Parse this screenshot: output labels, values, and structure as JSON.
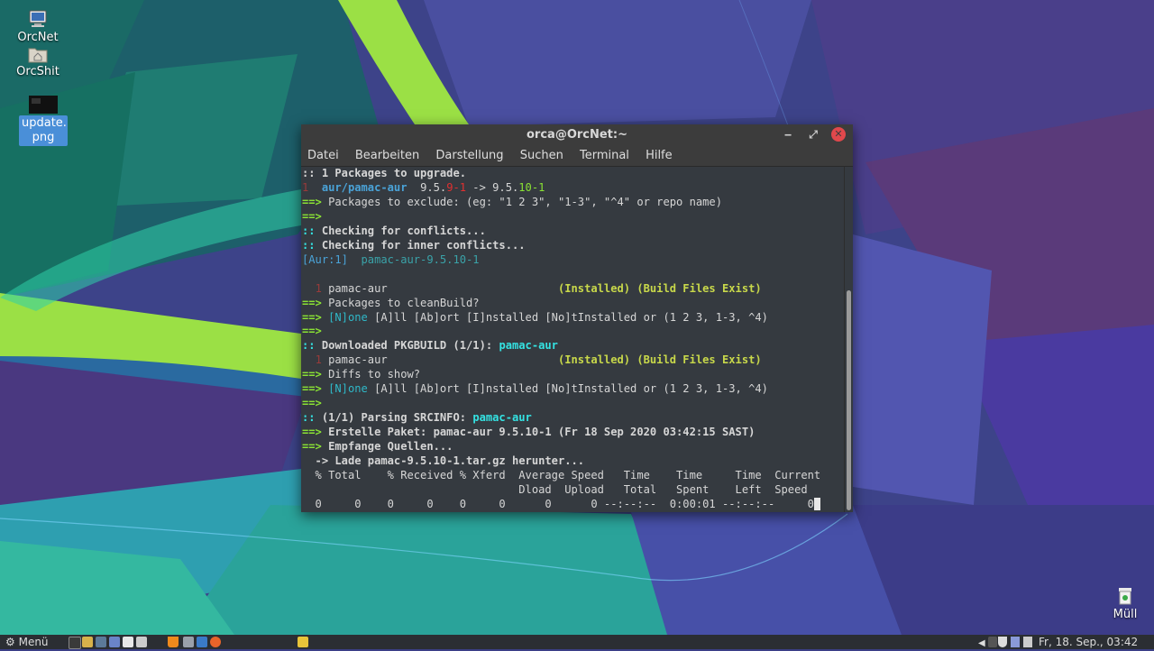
{
  "desktop": {
    "icons": [
      {
        "label": "OrcNet",
        "icon": "computer-icon"
      },
      {
        "label": "OrcShit",
        "icon": "home-folder-icon"
      },
      {
        "label": "update.\npng",
        "icon": "image-file-icon"
      },
      {
        "label": "Müll",
        "icon": "trash-icon"
      }
    ]
  },
  "window": {
    "title": "orca@OrcNet:~",
    "buttons": {
      "minimize": "‒",
      "maximize": "⤢",
      "close": "✕"
    },
    "menu": [
      "Datei",
      "Bearbeiten",
      "Darstellung",
      "Suchen",
      "Terminal",
      "Hilfe"
    ]
  },
  "terminal": {
    "l1": ":: 1 Packages to upgrade.",
    "l2_num": "1",
    "l2_pkg": "aur/pamac-aur",
    "l2_ver_a": "9.5.",
    "l2_ver_b": "9-1",
    "l2_arrow": " -> 9.5.",
    "l2_ver_c": "10-1",
    "l3": "Packages to exclude: (eg: \"1 2 3\", \"1-3\", \"^4\" or repo name)",
    "arrow": "==>",
    "colons": "::",
    "l5": "Checking for conflicts...",
    "l6": "Checking for inner conflicts...",
    "l7_tag": "[Aur:1]",
    "l7_pkg": "pamac-aur-9.5.10-1",
    "l9_num": "1",
    "l9_pkg": "pamac-aur",
    "l9_status": "(Installed) (Build Files Exist)",
    "l10": "Packages to cleanBuild?",
    "l11_none": "[N]one",
    "l11_rest": "[A]ll [Ab]ort [I]nstalled [No]tInstalled or (1 2 3, 1-3, ^4)",
    "l13": "Downloaded PKGBUILD (1/1):",
    "l13_pkg": "pamac-aur",
    "l15": "Diffs to show?",
    "l18": "(1/1) Parsing SRCINFO:",
    "l18_pkg": "pamac-aur",
    "l19": "Erstelle Paket: pamac-aur 9.5.10-1 (Fr 18 Sep 2020 03:42:15 SAST)",
    "l20": "Empfange Quellen...",
    "l21": "  -> Lade pamac-9.5.10-1.tar.gz herunter...",
    "l22": "  % Total    % Received % Xferd  Average Speed   Time    Time     Time  Current",
    "l23": "                                 Dload  Upload   Total   Spent    Left  Speed",
    "l24": "  0     0    0     0    0     0      0      0 --:--:--  0:00:01 --:--:--     0"
  },
  "taskbar": {
    "menu_label": "Menü",
    "clock": "Fr, 18. Sep., 03:42"
  }
}
